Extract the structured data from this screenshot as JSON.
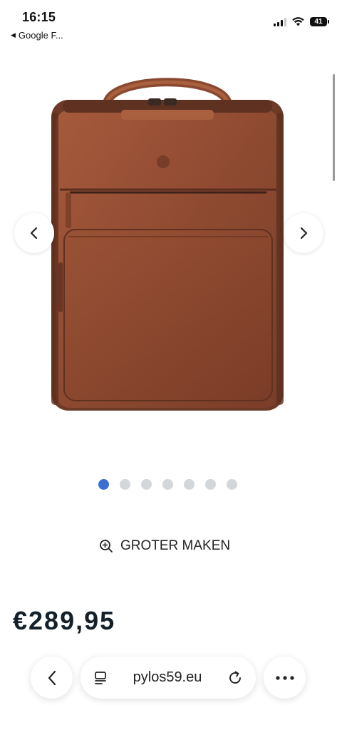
{
  "status_bar": {
    "time": "16:15",
    "back_app": "Google F...",
    "battery": "41"
  },
  "carousel": {
    "image": "backpack-image",
    "dot_count": 7,
    "active_index": 0
  },
  "zoom_label": "GROTER MAKEN",
  "price": "€289,95",
  "browser_bar": {
    "url": "pylos59.eu"
  },
  "colors": {
    "accent": "#3b6fd3",
    "leather": "#8e4a31"
  }
}
